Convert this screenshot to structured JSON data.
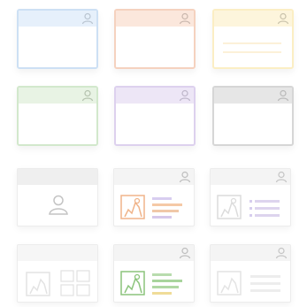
{
  "templates": [
    {
      "name": "blue",
      "border": "#cde0f4",
      "header": "#e6f0fb"
    },
    {
      "name": "orange",
      "border": "#f5d2bf",
      "header": "#fbe7dc"
    },
    {
      "name": "yellow",
      "border": "#fbeec4",
      "header": "#fdf5dc"
    },
    {
      "name": "green",
      "border": "#d2e8cc",
      "header": "#e8f3e4"
    },
    {
      "name": "purple",
      "border": "#ddd1ee",
      "header": "#ede6f6"
    },
    {
      "name": "gray",
      "border": "#d6d6d6",
      "header": "#e6e6e6"
    }
  ],
  "layouts": [
    {
      "name": "avatar-card",
      "style": "avatar"
    },
    {
      "name": "image-with-list-orange",
      "accent": "#f0b48a",
      "lines": [
        "#f5c9a6",
        "#f0c8a8",
        "#d6c8ea"
      ]
    },
    {
      "name": "image-with-list-faded",
      "accent": "#e6e6e6",
      "lines": [
        "#ddd4ee",
        "#ddd4ee",
        "#ddd4ee"
      ]
    },
    {
      "name": "image-gallery-faded",
      "accent": "#ececec"
    },
    {
      "name": "image-with-list-green",
      "accent": "#8cc47c",
      "lines": [
        "#b8dcae",
        "#a8d49c",
        "#f0dc98"
      ]
    },
    {
      "name": "image-with-list-gray",
      "accent": "#e9e9e9",
      "lines": [
        "#ededed",
        "#ededed",
        "#ededed"
      ]
    }
  ]
}
